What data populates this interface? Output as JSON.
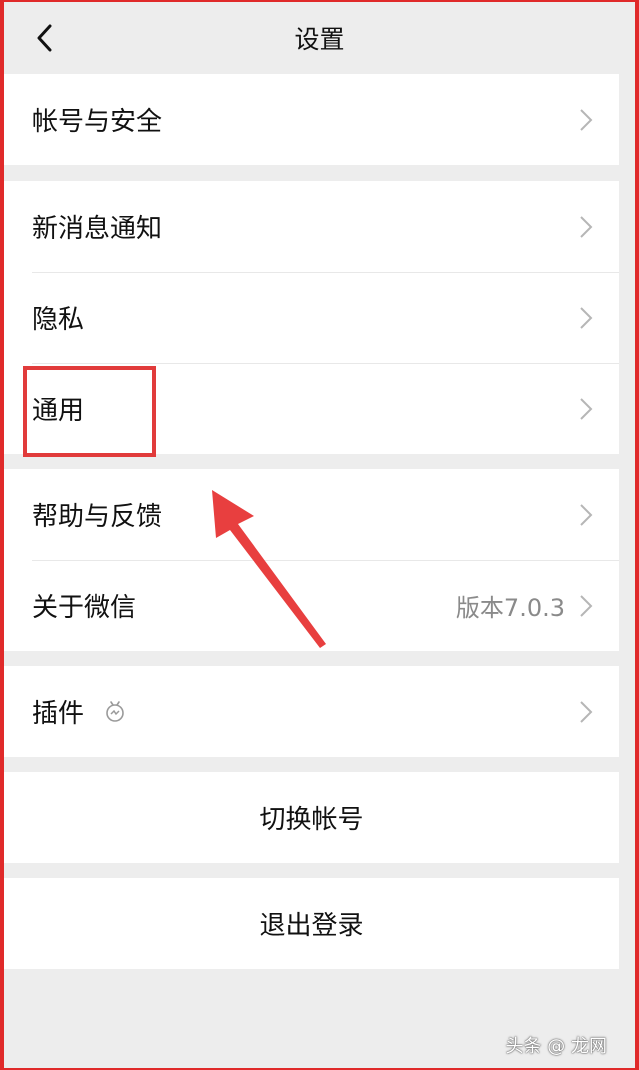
{
  "nav": {
    "title": "设置",
    "back_icon": "chevron-left-icon"
  },
  "groups": [
    {
      "items": [
        {
          "label": "帐号与安全"
        }
      ]
    },
    {
      "items": [
        {
          "label": "新消息通知"
        },
        {
          "label": "隐私"
        },
        {
          "label": "通用"
        }
      ]
    },
    {
      "items": [
        {
          "label": "帮助与反馈"
        },
        {
          "label": "关于微信",
          "value": "版本7.0.3"
        }
      ]
    },
    {
      "items": [
        {
          "label": "插件",
          "icon": "plugin-icon"
        }
      ]
    }
  ],
  "actions": {
    "switch_account": "切换帐号",
    "logout": "退出登录"
  },
  "annotation": {
    "highlight_color": "#e13b3b",
    "arrow_color": "#e83f3f"
  },
  "watermark": "头条 @ 龙网"
}
